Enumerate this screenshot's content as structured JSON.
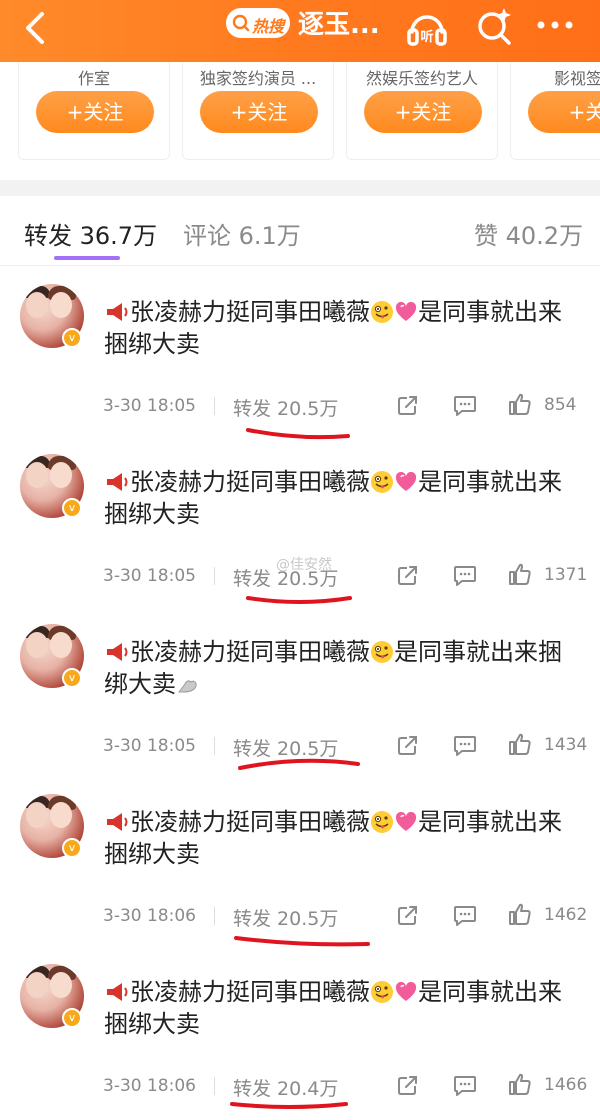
{
  "header": {
    "hot_label": "热搜",
    "title": "逐玉...",
    "back_icon": "back-chevron-icon",
    "listen_icon": "headphones-icon",
    "search_icon": "search-sparkle-icon",
    "more_icon": "more-dots-icon"
  },
  "cards": [
    {
      "desc": "作室",
      "follow": "+关注"
    },
    {
      "desc": "独家签约演员 ...",
      "follow": "+关注"
    },
    {
      "desc": "然娱乐签约艺人",
      "follow": "+关注"
    },
    {
      "desc": "影视签约",
      "follow": "+关"
    }
  ],
  "tabs": {
    "repost": "转发 36.7万",
    "comment": "评论 6.1万",
    "like": "赞 40.2万"
  },
  "watermark": "@佳安然",
  "posts": [
    {
      "text_before": "张凌赫力挺同事田曦薇",
      "text_after": "是同事就出来捆绑大卖",
      "end_emoji": "",
      "has_heart": true,
      "time": "3-30 18:05",
      "repost": "转发 20.5万",
      "likes": "854"
    },
    {
      "text_before": "张凌赫力挺同事田曦薇",
      "text_after": "是同事就出来捆绑大卖",
      "end_emoji": "",
      "has_heart": true,
      "time": "3-30 18:05",
      "repost": "转发 20.5万",
      "likes": "1371"
    },
    {
      "text_before": "张凌赫力挺同事田曦薇",
      "text_after": "是同事就出来捆绑大卖",
      "end_emoji": "muscle",
      "has_heart": false,
      "time": "3-30 18:05",
      "repost": "转发 20.5万",
      "likes": "1434"
    },
    {
      "text_before": "张凌赫力挺同事田曦薇",
      "text_after": "是同事就出来捆绑大卖",
      "end_emoji": "",
      "has_heart": true,
      "time": "3-30 18:06",
      "repost": "转发 20.5万",
      "likes": "1462"
    },
    {
      "text_before": "张凌赫力挺同事田曦薇",
      "text_after": "是同事就出来捆绑大卖",
      "end_emoji": "",
      "has_heart": true,
      "time": "3-30 18:06",
      "repost": "转发 20.4万",
      "likes": "1466"
    }
  ],
  "colors": {
    "header_orange": "#ff7a1e",
    "follow_orange": "#ff8a1e",
    "tab_indicator": "#a371f7",
    "underline_red": "#e0141e"
  }
}
